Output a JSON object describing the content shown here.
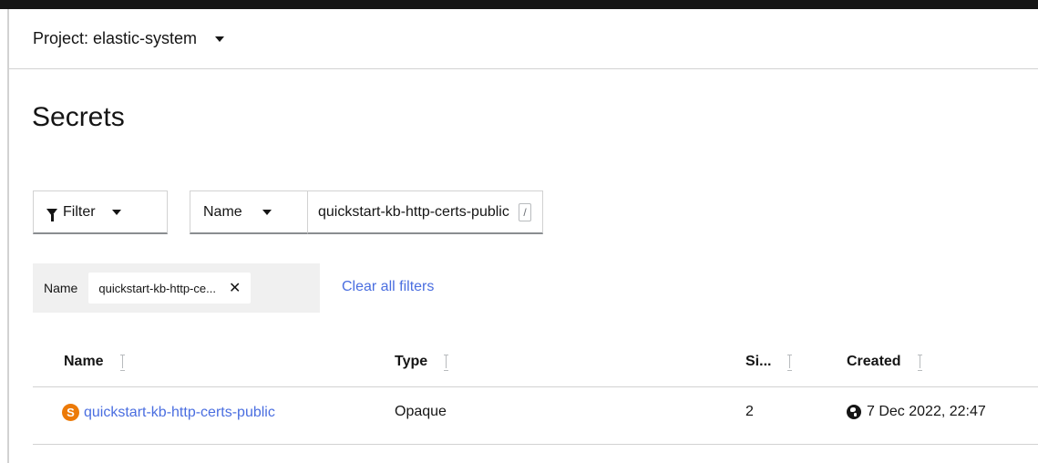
{
  "project": {
    "label": "Project: elastic-system"
  },
  "page": {
    "title": "Secrets"
  },
  "toolbar": {
    "filter_label": "Filter",
    "name_select_label": "Name",
    "search_value": "quickstart-kb-http-certs-public",
    "search_shortcut": "/"
  },
  "active_filters": {
    "group_label": "Name",
    "chip_value": "quickstart-kb-http-ce...",
    "clear_all_label": "Clear all filters"
  },
  "table": {
    "columns": [
      "Name",
      "Type",
      "Si...",
      "Created"
    ],
    "rows": [
      {
        "badge": "S",
        "name": "quickstart-kb-http-certs-public",
        "type": "Opaque",
        "size": "2",
        "created": "7 Dec 2022, 22:47"
      }
    ]
  },
  "colors": {
    "link": "#4a6ee0",
    "secret_badge": "#ec7a08",
    "top_bar": "#151515",
    "chip_group_bg": "#f0f0f0"
  },
  "icons": [
    "caret-down-icon",
    "filter-icon",
    "close-icon",
    "sort-icon",
    "globe-icon"
  ]
}
